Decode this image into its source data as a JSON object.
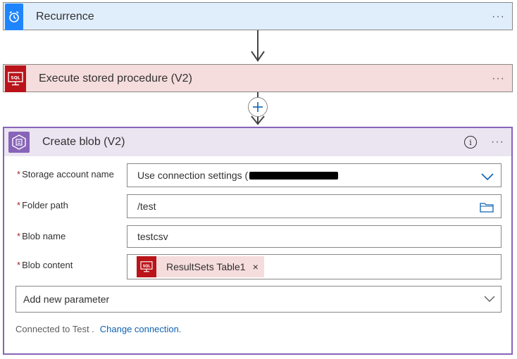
{
  "steps": {
    "recurrence": {
      "title": "Recurrence",
      "more": "···",
      "icon": "alarm-clock-icon"
    },
    "execute": {
      "title": "Execute stored procedure (V2)",
      "more": "···",
      "icon": "sql-icon"
    },
    "blob": {
      "title": "Create blob (V2)",
      "more": "···",
      "info": "i",
      "icon": "blob-storage-icon",
      "fields": {
        "storage": {
          "label": "Storage account name",
          "value": "Use connection settings ("
        },
        "folder": {
          "label": "Folder path",
          "value": "/test"
        },
        "blobname": {
          "label": "Blob name",
          "value": "testcsv"
        },
        "content": {
          "label": "Blob content",
          "token": "ResultSets Table1",
          "token_close": "×"
        }
      },
      "add_parameter": "Add new parameter",
      "footer": {
        "connected": "Connected to Test .",
        "change": "Change connection."
      }
    }
  },
  "colors": {
    "recurrence_bg": "#e0eefc",
    "recurrence_icon": "#1f85ff",
    "sql_bg": "#f5dcdd",
    "sql_icon": "#ba141a",
    "blob_accent": "#8764b8",
    "link": "#0f62b0",
    "required": "#a4262c"
  }
}
